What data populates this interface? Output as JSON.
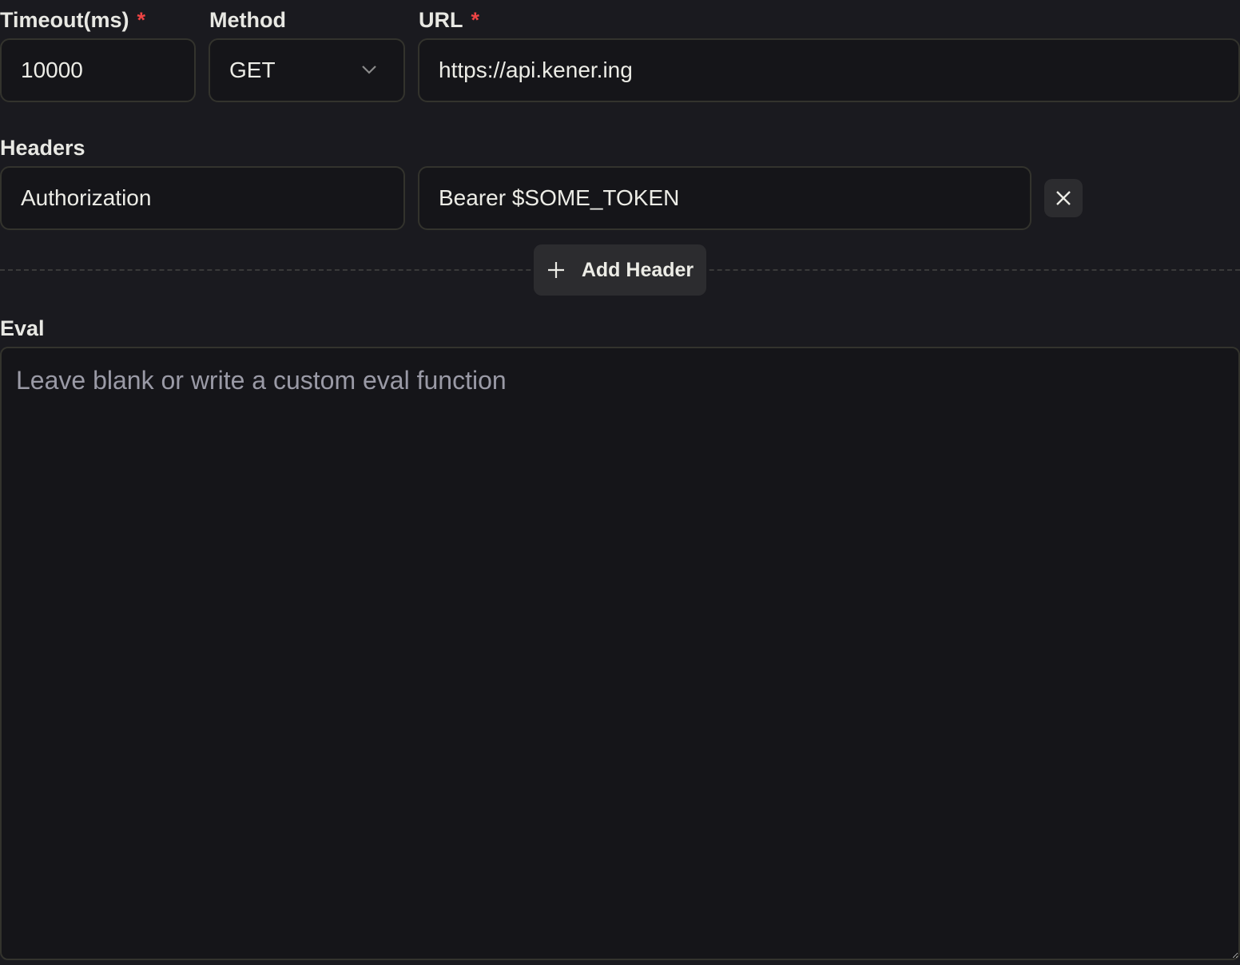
{
  "timeout": {
    "label": "Timeout(ms)",
    "required_mark": "*",
    "value": "10000"
  },
  "method": {
    "label": "Method",
    "value": "GET"
  },
  "url": {
    "label": "URL",
    "required_mark": "*",
    "value": "https://api.kener.ing"
  },
  "headers": {
    "label": "Headers",
    "items": [
      {
        "key": "Authorization",
        "value": "Bearer $SOME_TOKEN"
      }
    ],
    "add_label": "Add Header"
  },
  "eval": {
    "label": "Eval",
    "placeholder": "Leave blank or write a custom eval function",
    "value": ""
  },
  "colors": {
    "background": "#1a1a1f",
    "required": "#ef4444",
    "button": "#2c2c2f"
  }
}
